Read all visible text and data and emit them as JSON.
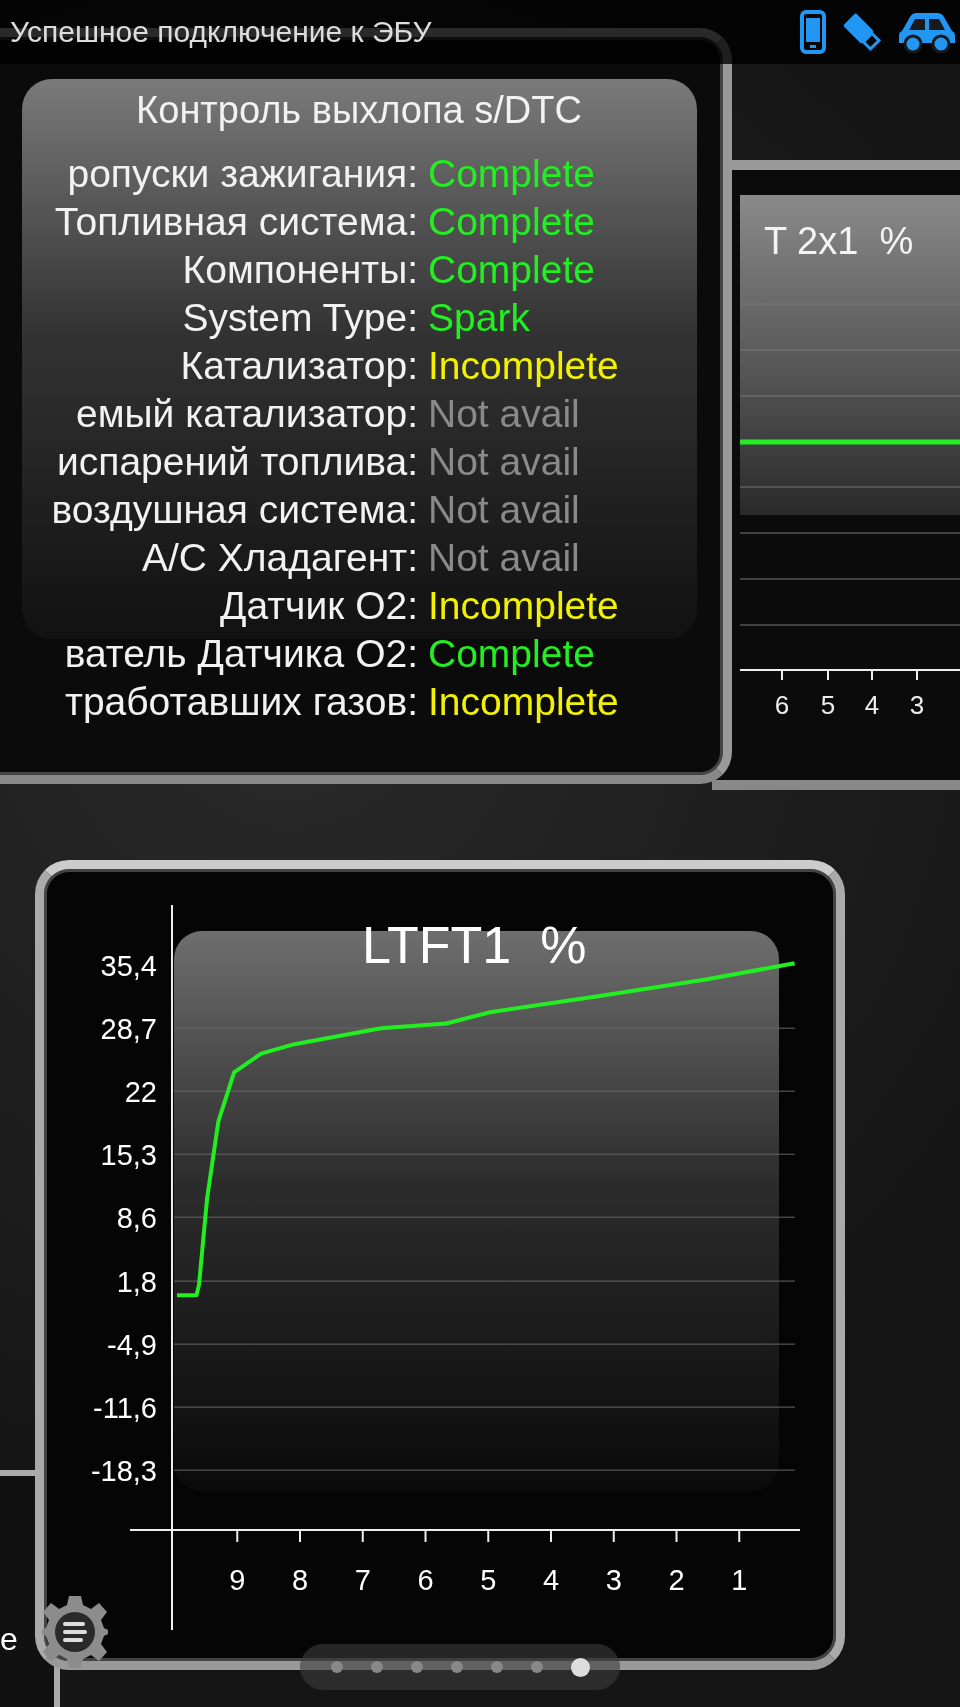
{
  "status_bar": {
    "message": "Успешное подключение к ЭБУ"
  },
  "monitor_panel": {
    "title": "Контроль выхлопа s/DTC",
    "rows": [
      {
        "label": "ропуски зажигания:",
        "value": "Complete",
        "color": "#22ee22"
      },
      {
        "label": "Топливная система:",
        "value": "Complete",
        "color": "#22ee22"
      },
      {
        "label": "Компоненты:",
        "value": "Complete",
        "color": "#22ee22"
      },
      {
        "label": "System Type:",
        "value": "Spark",
        "color": "#22ee22"
      },
      {
        "label": "Катализатор:",
        "value": "Incomplete",
        "color": "#f2f200"
      },
      {
        "label": "емый катализатор:",
        "value": "Not avail",
        "color": "#8a8a8a"
      },
      {
        "label": "испарений топлива:",
        "value": "Not avail",
        "color": "#8a8a8a"
      },
      {
        "label": "воздушная система:",
        "value": "Not avail",
        "color": "#8a8a8a"
      },
      {
        "label": "A/C Хладагент:",
        "value": "Not avail",
        "color": "#8a8a8a"
      },
      {
        "label": "Датчик O2:",
        "value": "Incomplete",
        "color": "#f2f200"
      },
      {
        "label": "ватель Датчика O2:",
        "value": "Complete",
        "color": "#22ee22"
      },
      {
        "label": "тработавших газов:",
        "value": "Incomplete",
        "color": "#f2f200"
      }
    ]
  },
  "side_gauge": {
    "title": "T 2x1  %",
    "x_labels": [
      "6",
      "5",
      "4",
      "3"
    ]
  },
  "chart_panel": {
    "title": "LTFT1  %",
    "chart_data": {
      "type": "line",
      "xlim": [
        10.04,
        0
      ],
      "ylim": [
        -35.3,
        41.8
      ],
      "grid": true,
      "xticks": [
        9,
        8,
        7,
        6,
        5,
        4,
        3,
        2,
        1
      ],
      "yticks": [
        {
          "value": 35.4,
          "label": "35,4"
        },
        {
          "value": 28.7,
          "label": "28,7"
        },
        {
          "value": 22,
          "label": "22"
        },
        {
          "value": 15.3,
          "label": "15,3"
        },
        {
          "value": 8.6,
          "label": "8,6"
        },
        {
          "value": 1.8,
          "label": "1,8"
        },
        {
          "value": -4.9,
          "label": "-4,9"
        },
        {
          "value": -11.6,
          "label": "-11,6"
        },
        {
          "value": -18.3,
          "label": "-18,3"
        }
      ],
      "x": [
        9.96,
        9.65,
        9.61,
        9.48,
        9.3,
        9.05,
        8.62,
        8.09,
        6.71,
        5.67,
        4.97,
        3.25,
        1.51,
        0.12
      ],
      "series": [
        {
          "color": "#22ee22",
          "values": [
            0.3,
            0.3,
            1.4,
            10.6,
            18.8,
            24,
            26,
            27,
            28.7,
            29.2,
            30.4,
            32.1,
            33.9,
            35.6
          ]
        }
      ]
    }
  },
  "left_panel": {
    "text": "е"
  },
  "pager": {
    "pages": [
      {
        "selected": false
      },
      {
        "selected": false
      },
      {
        "selected": false
      },
      {
        "selected": false
      },
      {
        "selected": false
      },
      {
        "selected": false
      },
      {
        "selected": true
      }
    ]
  }
}
